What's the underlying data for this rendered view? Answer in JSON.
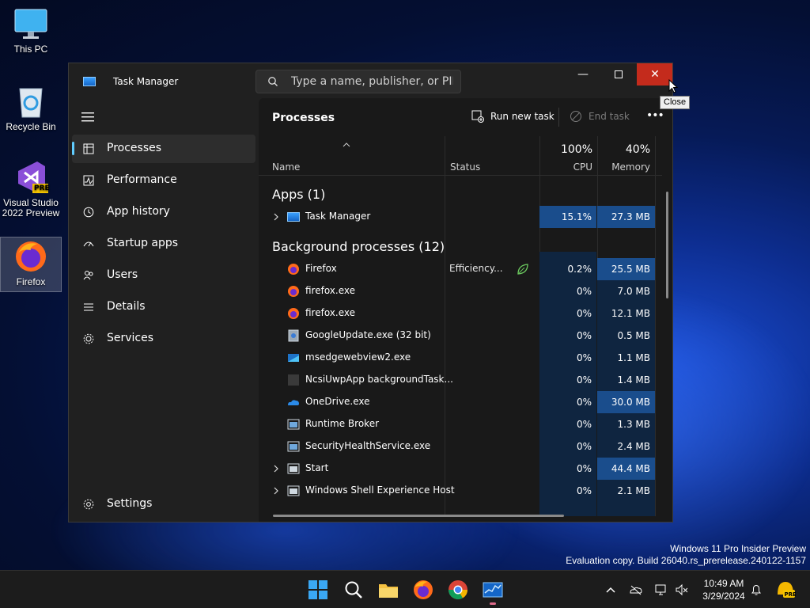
{
  "desktop": {
    "icons": [
      {
        "label_lines": [
          "This PC"
        ]
      },
      {
        "label_lines": [
          "Recycle Bin"
        ]
      },
      {
        "label_lines": [
          "Visual Studio",
          "2022 Preview"
        ],
        "badge": "PRE"
      },
      {
        "label_lines": [
          "Firefox"
        ]
      }
    ],
    "watermark": [
      "Windows 11 Pro Insider Preview",
      "Evaluation copy. Build 26040.rs_prerelease.240122-1157"
    ]
  },
  "window": {
    "title": "Task Manager",
    "search_placeholder": "Type a name, publisher, or PID...",
    "tooltip": "Close"
  },
  "sidebar": {
    "items": [
      {
        "label": "Processes",
        "icon": "processes-icon",
        "active": true
      },
      {
        "label": "Performance",
        "icon": "performance-icon"
      },
      {
        "label": "App history",
        "icon": "app-history-icon"
      },
      {
        "label": "Startup apps",
        "icon": "startup-apps-icon"
      },
      {
        "label": "Users",
        "icon": "users-icon"
      },
      {
        "label": "Details",
        "icon": "details-icon"
      },
      {
        "label": "Services",
        "icon": "services-icon"
      }
    ],
    "settings": "Settings"
  },
  "main": {
    "page_title": "Processes",
    "run_new_task": "Run new task",
    "end_task": "End task",
    "columns": {
      "name": "Name",
      "status": "Status",
      "cpu_pct": "100%",
      "cpu": "CPU",
      "mem_pct": "40%",
      "memory": "Memory"
    },
    "groups": [
      {
        "label": "Apps (1)"
      },
      {
        "label": "Background processes (12)"
      }
    ],
    "apps": [
      {
        "name": "Task Manager",
        "cpu": "15.1%",
        "memory": "27.3 MB",
        "expandable": true,
        "icon": "task-manager-icon"
      }
    ],
    "background": [
      {
        "name": "Firefox",
        "status": "Efficiency...",
        "cpu": "0.2%",
        "memory": "25.5 MB",
        "icon": "firefox-icon",
        "efficiency": true
      },
      {
        "name": "firefox.exe",
        "status": "",
        "cpu": "0%",
        "memory": "7.0 MB",
        "icon": "firefox-icon"
      },
      {
        "name": "firefox.exe",
        "status": "",
        "cpu": "0%",
        "memory": "12.1 MB",
        "icon": "firefox-icon"
      },
      {
        "name": "GoogleUpdate.exe (32 bit)",
        "status": "",
        "cpu": "0%",
        "memory": "0.5 MB",
        "icon": "google-update-icon"
      },
      {
        "name": "msedgewebview2.exe",
        "status": "",
        "cpu": "0%",
        "memory": "1.1 MB",
        "icon": "edge-webview-icon"
      },
      {
        "name": "NcsiUwpApp backgroundTask...",
        "status": "",
        "cpu": "0%",
        "memory": "1.4 MB",
        "icon": "app-icon"
      },
      {
        "name": "OneDrive.exe",
        "status": "",
        "cpu": "0%",
        "memory": "30.0 MB",
        "icon": "onedrive-icon"
      },
      {
        "name": "Runtime Broker",
        "status": "",
        "cpu": "0%",
        "memory": "1.3 MB",
        "icon": "window-icon"
      },
      {
        "name": "SecurityHealthService.exe",
        "status": "",
        "cpu": "0%",
        "memory": "2.4 MB",
        "icon": "window-icon"
      },
      {
        "name": "Start",
        "status": "",
        "cpu": "0%",
        "memory": "44.4 MB",
        "icon": "window-icon",
        "expandable": true
      },
      {
        "name": "Windows Shell Experience Host",
        "status": "",
        "cpu": "0%",
        "memory": "2.1 MB",
        "icon": "window-icon",
        "expandable": true
      }
    ]
  },
  "taskbar": {
    "clock_time": "10:49 AM",
    "clock_date": "3/29/2024"
  }
}
